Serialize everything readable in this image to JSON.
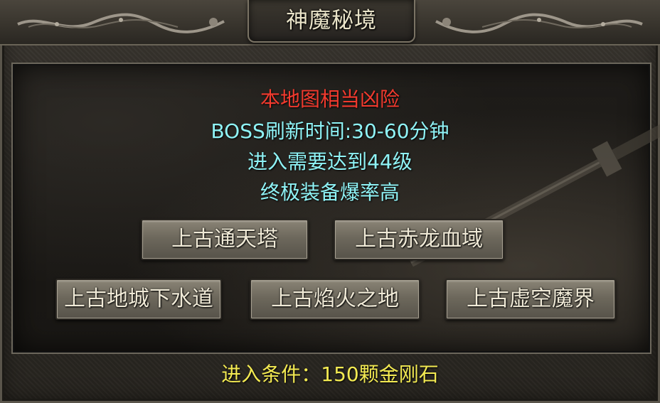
{
  "window": {
    "title": "神魔秘境"
  },
  "info": {
    "warning": "本地图相当凶险",
    "boss_refresh": "BOSS刷新时间:30-60分钟",
    "level_requirement": "进入需要达到44级",
    "drop_rate": "终极装备爆率高"
  },
  "destinations": [
    {
      "label": "上古通天塔"
    },
    {
      "label": "上古赤龙血域"
    },
    {
      "label": "上古地城下水道"
    },
    {
      "label": "上古焰火之地"
    },
    {
      "label": "上古虚空魔界"
    }
  ],
  "footer": {
    "entry_condition": "进入条件：150颗金刚石"
  },
  "colors": {
    "warning": "#f23a2e",
    "info": "#8ff3f6",
    "condition": "#f3ea52",
    "title": "#e9e3c8"
  }
}
